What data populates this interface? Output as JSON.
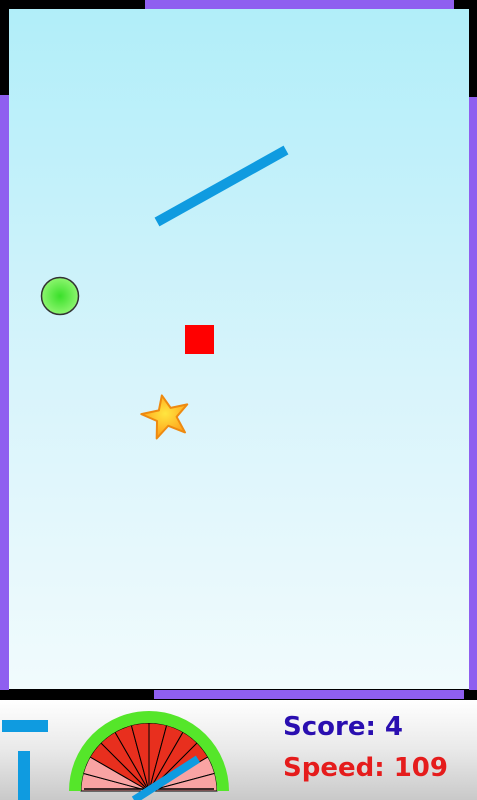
{
  "hud": {
    "score_label": "Score:",
    "score_value": "4",
    "speed_label": "Speed:",
    "speed_value": "109",
    "score_color": "#2a0fb0",
    "speed_color": "#e51c1c"
  },
  "colors": {
    "wall": "#8f5ff0",
    "paddle": "#0f9be0",
    "block": "#ff0000",
    "ball": "#59ea3e",
    "star": "#ffc21a",
    "gauge_ring": "#55e62a",
    "gauge_fill_dark": "#e82f1e",
    "gauge_fill_light": "#f9a3a3"
  },
  "objects": {
    "ball_icon": "ball-icon",
    "block_icon": "red-block-icon",
    "star_icon": "star-icon",
    "paddle_icon": "paddle-icon"
  },
  "gauge": {
    "segments_total": 12,
    "segments_filled": 8
  }
}
